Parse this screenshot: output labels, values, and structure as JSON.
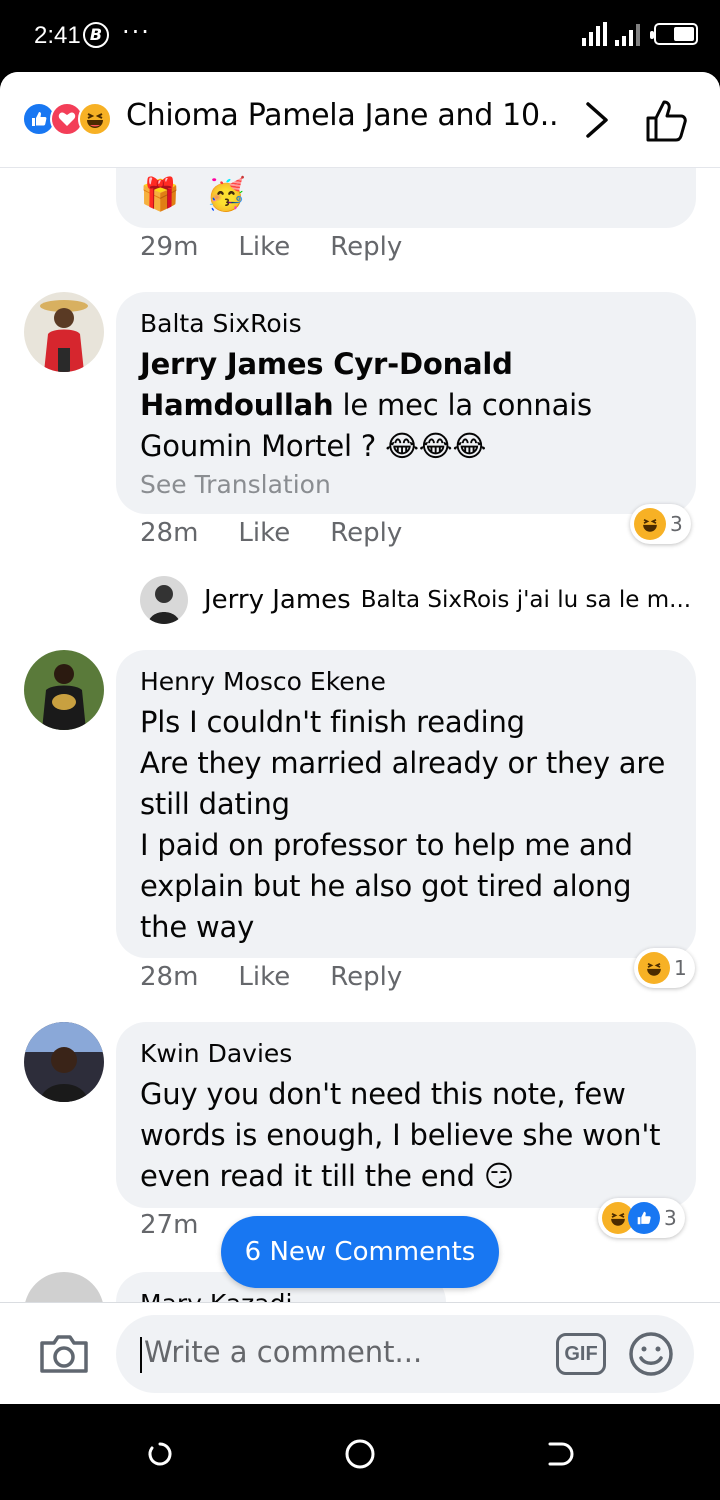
{
  "status_bar": {
    "time": "2:41",
    "b_badge": "B",
    "dots": "···"
  },
  "header": {
    "reaction_icons": [
      "like-icon",
      "love-icon",
      "haha-icon"
    ],
    "title": "Chioma Pamela Jane and 10..."
  },
  "comments": [
    {
      "author": "",
      "text": "",
      "emojis": "🎁 🥳",
      "time": "29m",
      "like_label": "Like",
      "reply_label": "Reply"
    },
    {
      "author": "Balta SixRois",
      "mention": "Jerry James Cyr-Donald Hamdoullah",
      "text": " le mec la connais Goumin Mortel ? 😂😂😂",
      "see_translation": "See Translation",
      "time": "28m",
      "like_label": "Like",
      "reply_label": "Reply",
      "reaction_count": "3"
    },
    {
      "author": "Henry Mosco Ekene",
      "text": "Pls I couldn't finish reading\nAre they married already or they are still dating\nI paid on professor to help me and explain but he also got tired along the way",
      "time": "28m",
      "like_label": "Like",
      "reply_label": "Reply",
      "reaction_count": "1"
    },
    {
      "author": "Kwin Davies",
      "text": "Guy you don't need this note, few words is enough, I believe she won't even read it till the end 😏",
      "time": "27m",
      "reaction_count": "3"
    },
    {
      "author": "Mary Kazadi"
    }
  ],
  "reply_preview": {
    "author": "Jerry James",
    "text": "Balta SixRois j'ai lu sa le m..."
  },
  "new_comments_button": "6 New Comments",
  "composer": {
    "placeholder": "Write a comment...",
    "gif_label": "GIF"
  },
  "colors": {
    "accent": "#1877f2",
    "bubble": "#f0f2f5",
    "haha": "#f7b125",
    "love": "#f33e58"
  }
}
